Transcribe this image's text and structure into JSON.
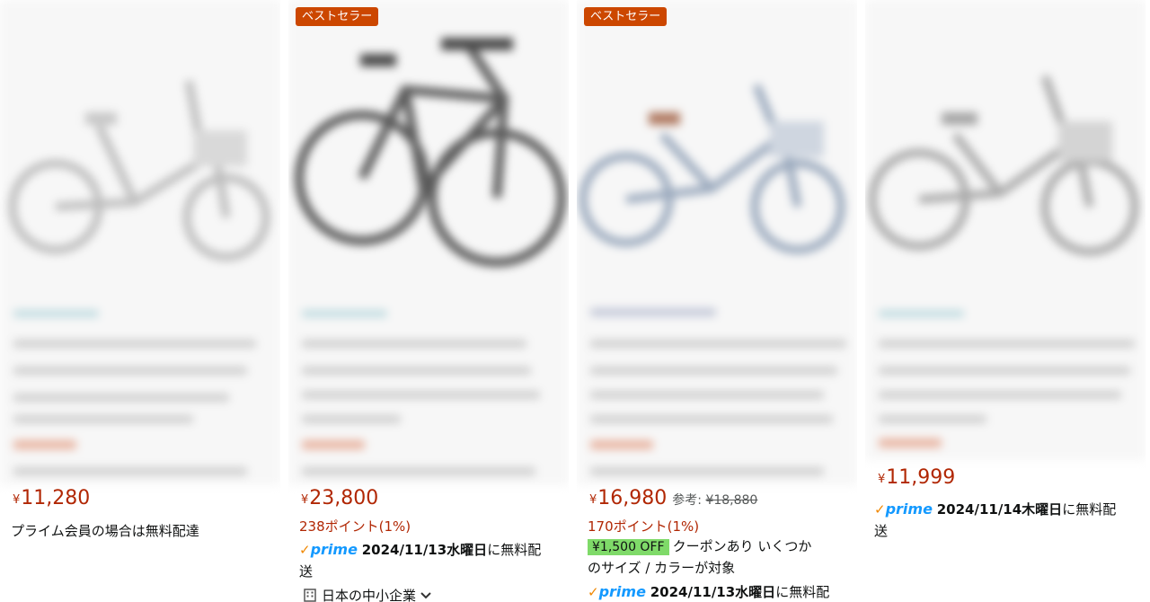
{
  "products": [
    {
      "badge": "",
      "price_symbol": "¥",
      "price": "11,280",
      "shipping_note": "プライム会員の場合は無料配達"
    },
    {
      "badge": "ベストセラー",
      "price_symbol": "¥",
      "price": "23,800",
      "points": "238ポイント(1%)",
      "prime_check": "✓",
      "prime_label": "prime",
      "delivery_date": "2024/11/13水曜日",
      "delivery_suffix_1": "に無料配",
      "delivery_suffix_2": "送",
      "sme_label": "日本の中小企業"
    },
    {
      "badge": "ベストセラー",
      "price_symbol": "¥",
      "price": "16,980",
      "ref_label": "参考:",
      "ref_price": "¥18,880",
      "points": "170ポイント(1%)",
      "coupon": "¥1,500 OFF",
      "coupon_text_1": "クーポンあり いくつか",
      "coupon_text_2": "のサイズ / カラーが対象",
      "prime_check": "✓",
      "prime_label": "prime",
      "delivery_date": "2024/11/13水曜日",
      "delivery_suffix_1": "に無料配"
    },
    {
      "badge": "",
      "price_symbol": "¥",
      "price": "11,999",
      "prime_check": "✓",
      "prime_label": "prime",
      "delivery_date": "2024/11/14木曜日",
      "delivery_suffix_1": "に無料配",
      "delivery_suffix_2": "送"
    }
  ]
}
